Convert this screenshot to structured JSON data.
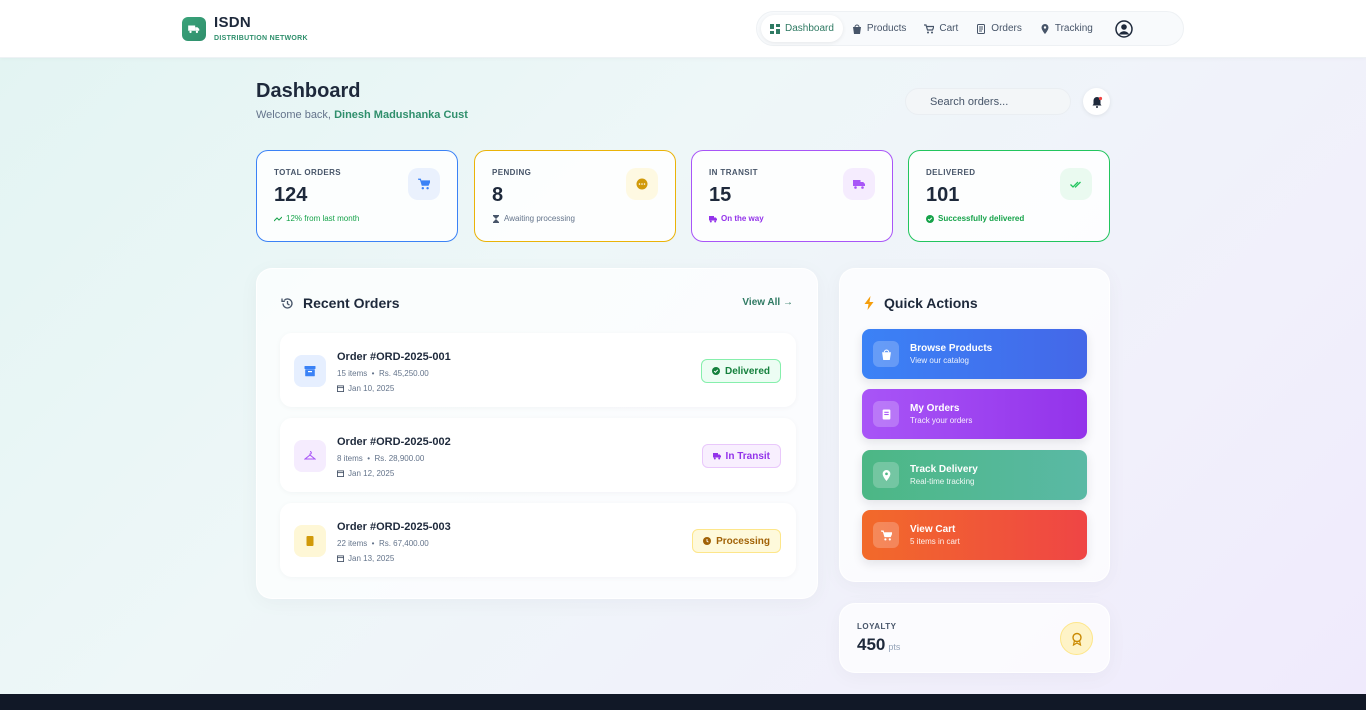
{
  "brand": {
    "name": "ISDN",
    "tagline": "DISTRIBUTION NETWORK"
  },
  "nav": {
    "items": [
      {
        "label": "Dashboard",
        "icon": "grid-icon",
        "active": true
      },
      {
        "label": "Products",
        "icon": "bag-icon"
      },
      {
        "label": "Cart",
        "icon": "cart-icon"
      },
      {
        "label": "Orders",
        "icon": "receipt-icon"
      },
      {
        "label": "Tracking",
        "icon": "location-pin-icon"
      }
    ],
    "profile_icon": "user-circle-icon"
  },
  "page": {
    "title": "Dashboard",
    "welcome_prefix": "Welcome back,",
    "user_name": "Dinesh Madushanka Cust"
  },
  "search": {
    "placeholder": "Search orders..."
  },
  "stats": [
    {
      "label": "TOTAL ORDERS",
      "value": "124",
      "sub": "12% from last month",
      "color": "#3b82f6",
      "sub_color": "#16a34a",
      "icon": "cart-icon"
    },
    {
      "label": "PENDING",
      "value": "8",
      "sub": "Awaiting processing",
      "color": "#eab308",
      "sub_color": "#64748b",
      "icon": "clock-icon"
    },
    {
      "label": "IN TRANSIT",
      "value": "15",
      "sub": "On the way",
      "color": "#a855f7",
      "sub_color": "#9333ea",
      "icon": "truck-icon"
    },
    {
      "label": "DELIVERED",
      "value": "101",
      "sub": "Successfully delivered",
      "color": "#22c55e",
      "sub_color": "#16a34a",
      "icon": "double-check-icon"
    }
  ],
  "recent_orders": {
    "title": "Recent Orders",
    "view_all": "View All →",
    "orders": [
      {
        "id": "Order #ORD-2025-001",
        "items": "15 items",
        "amount": "Rs. 45,250.00",
        "date": "Jan 10, 2025",
        "status": "Delivered",
        "icon": "archive-box-icon"
      },
      {
        "id": "Order #ORD-2025-002",
        "items": "8 items",
        "amount": "Rs. 28,900.00",
        "date": "Jan 12, 2025",
        "status": "In Transit",
        "icon": "hanger-icon"
      },
      {
        "id": "Order #ORD-2025-003",
        "items": "22 items",
        "amount": "Rs. 67,400.00",
        "date": "Jan 13, 2025",
        "status": "Processing",
        "icon": "document-icon"
      }
    ]
  },
  "quick_actions": {
    "title": "Quick Actions",
    "items": [
      {
        "title": "Browse Products",
        "subtitle": "View our catalog",
        "icon": "bag-icon"
      },
      {
        "title": "My Orders",
        "subtitle": "Track your orders",
        "icon": "receipt-icon"
      },
      {
        "title": "Track Delivery",
        "subtitle": "Real-time tracking",
        "icon": "location-pin-icon"
      },
      {
        "title": "View Cart",
        "subtitle": "5 items in cart",
        "icon": "cart-icon"
      }
    ]
  },
  "loyalty": {
    "label": "LOYALTY",
    "value": "450",
    "unit": "pts",
    "icon": "award-icon"
  },
  "colors": {
    "brand": "#2f8f6c",
    "text": "#1e293b",
    "footer": "#111827"
  }
}
